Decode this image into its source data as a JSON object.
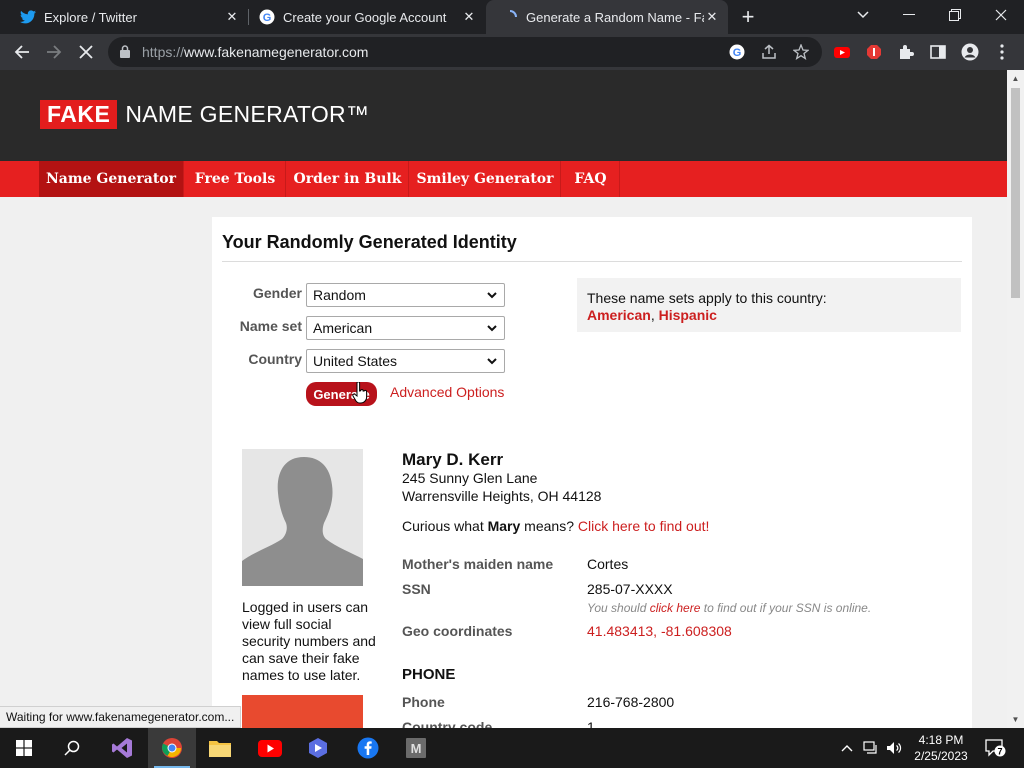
{
  "browser": {
    "tabs": [
      {
        "title": "Explore / Twitter",
        "favicon": "twitter-icon",
        "active": false
      },
      {
        "title": "Create your Google Account",
        "favicon": "google-icon",
        "active": false
      },
      {
        "title": "Generate a Random Name - Fake",
        "favicon": "loading-spinner-icon",
        "active": true
      }
    ],
    "url_proto": "https://",
    "url_host": "www.fakenamegenerator.com",
    "status_text": "Waiting for www.fakenamegenerator.com..."
  },
  "site": {
    "logo_fake": "FAKE",
    "logo_rest": "NAME GENERATOR™",
    "nav": [
      "Name Generator",
      "Free Tools",
      "Order in Bulk",
      "Smiley Generator",
      "FAQ"
    ]
  },
  "form": {
    "title": "Your Randomly Generated Identity",
    "gender_label": "Gender",
    "gender_value": "Random",
    "nameset_label": "Name set",
    "nameset_value": "American",
    "country_label": "Country",
    "country_value": "United States",
    "generate_label": "Generate",
    "advanced_label": "Advanced Options",
    "nameset_info": "These name sets apply to this country:",
    "nameset_1": "American",
    "nameset_sep": ",",
    "nameset_2": "Hispanic"
  },
  "identity": {
    "name": "Mary D. Kerr",
    "address_line1": "245 Sunny Glen Lane",
    "address_line2": "Warrensville Heights, OH 44128",
    "curious_prefix": "Curious what ",
    "curious_name": "Mary",
    "curious_mid": " means? ",
    "curious_link": "Click here to find out!",
    "login_note": "Logged in users can view full social security numbers and can save their fake names to use later.",
    "fields": {
      "maiden_label": "Mother's maiden name",
      "maiden_value": "Cortes",
      "ssn_label": "SSN",
      "ssn_value": "285-07-XXXX",
      "ssn_note_prefix": "You should ",
      "ssn_note_link": "click here",
      "ssn_note_suffix": " to find out if your SSN is online.",
      "geo_label": "Geo coordinates",
      "geo_value": "41.483413, -81.608308"
    },
    "phone_heading": "PHONE",
    "phone_label": "Phone",
    "phone_value": "216-768-2800",
    "country_code_label": "Country code",
    "country_code_value": "1"
  },
  "taskbar": {
    "time": "4:18 PM",
    "date": "2/25/2023",
    "notification_count": "7"
  }
}
